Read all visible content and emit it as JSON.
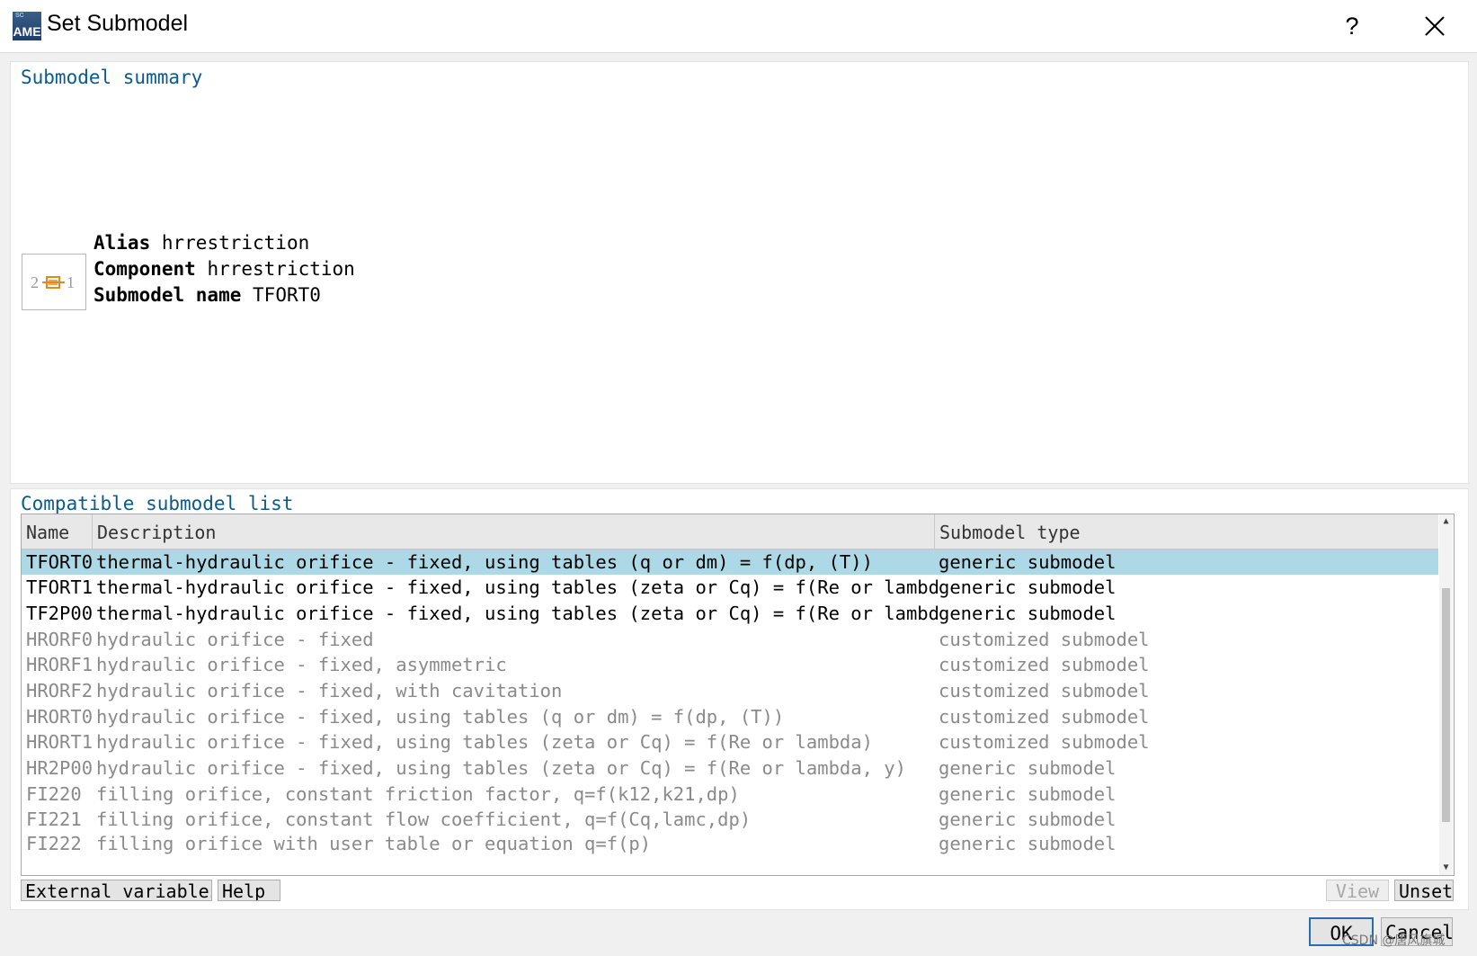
{
  "window": {
    "title": "Set Submodel",
    "help_label": "?",
    "icon": {
      "name": "AME",
      "sup": "SC"
    }
  },
  "summary": {
    "title": "Submodel summary",
    "component_icon": {
      "left_port": "2",
      "right_port": "1"
    },
    "alias_label": "Alias",
    "alias_value": "hrrestriction",
    "component_label": "Component",
    "component_value": "hrrestriction",
    "submodel_name_label": "Submodel name",
    "submodel_name_value": "TFORT0"
  },
  "list": {
    "title": "Compatible submodel list",
    "columns": [
      "Name",
      "Description",
      "Submodel type"
    ],
    "rows": [
      {
        "name": "TFORT0",
        "description": "thermal-hydraulic orifice - fixed, using tables (q or dm) = f(dp, (T))",
        "type": "generic submodel",
        "selected": true,
        "enabled": true
      },
      {
        "name": "TFORT1",
        "description": "thermal-hydraulic orifice - fixed, using tables (zeta or Cq) = f(Re or lambda)",
        "type": "generic submodel",
        "selected": false,
        "enabled": true
      },
      {
        "name": "TF2P00",
        "description": "thermal-hydraulic orifice - fixed, using tables (zeta or Cq) = f(Re or lambda, y)",
        "type": "generic submodel",
        "selected": false,
        "enabled": true
      },
      {
        "name": "HRORF0",
        "description": "hydraulic orifice - fixed",
        "type": "customized submodel",
        "selected": false,
        "enabled": false
      },
      {
        "name": "HRORF1",
        "description": "hydraulic orifice - fixed, asymmetric",
        "type": "customized submodel",
        "selected": false,
        "enabled": false
      },
      {
        "name": "HRORF2",
        "description": "hydraulic orifice - fixed, with cavitation",
        "type": "customized submodel",
        "selected": false,
        "enabled": false
      },
      {
        "name": "HRORT0",
        "description": "hydraulic orifice - fixed, using tables (q or dm) = f(dp, (T))",
        "type": "customized submodel",
        "selected": false,
        "enabled": false
      },
      {
        "name": "HRORT1",
        "description": "hydraulic orifice - fixed, using tables (zeta or Cq) = f(Re or lambda)",
        "type": "customized submodel",
        "selected": false,
        "enabled": false
      },
      {
        "name": "HR2P00",
        "description": "hydraulic orifice - fixed, using tables (zeta or Cq) = f(Re or lambda, y)",
        "type": "generic submodel",
        "selected": false,
        "enabled": false
      },
      {
        "name": "FI220",
        "description": "filling orifice, constant friction factor, q=f(k12,k21,dp)",
        "type": "generic submodel",
        "selected": false,
        "enabled": false
      },
      {
        "name": "FI221",
        "description": "filling orifice, constant flow coefficient, q=f(Cq,lamc,dp)",
        "type": "generic submodel",
        "selected": false,
        "enabled": false
      },
      {
        "name": "FI222",
        "description": "filling orifice with user table or equation q=f(p)",
        "type": "generic submodel",
        "selected": false,
        "enabled": false
      }
    ],
    "colors": {
      "selected_row": "#add8e6",
      "enabled_text": "#000000",
      "disabled_text": "#8a8a8a"
    }
  },
  "buttons": {
    "external_variables": "External variables",
    "help": "Help",
    "view": "View",
    "unset": "Unset",
    "ok": "OK",
    "cancel": "Cancel"
  },
  "watermark": "CSDN @唐风旗城"
}
